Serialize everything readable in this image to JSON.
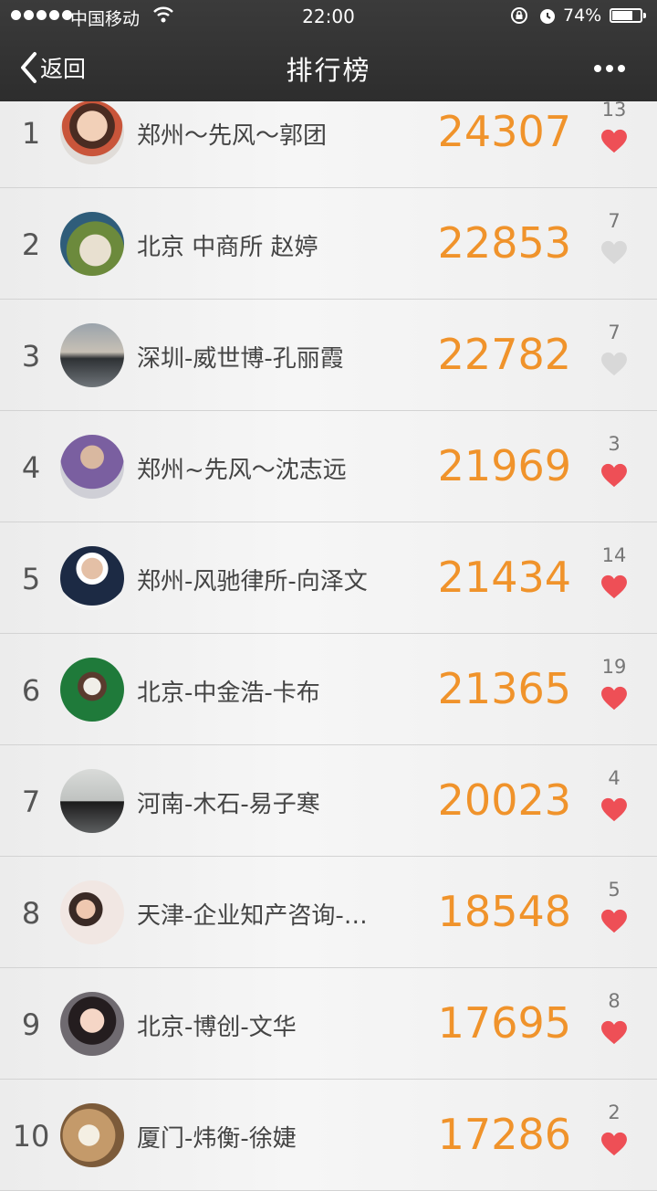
{
  "status_bar": {
    "carrier": "中国移动",
    "time": "22:00",
    "battery_pct": "74%",
    "battery_level": 0.74,
    "icons": [
      "signal-dots-icon",
      "wifi-icon",
      "rotation-lock-icon",
      "alarm-icon",
      "battery-icon"
    ]
  },
  "nav": {
    "back_label": "返回",
    "title": "排行榜"
  },
  "colors": {
    "score": "#f0932b",
    "heart_on": "#ee4f56",
    "heart_off": "#d8d8d8",
    "nav_bg": "#333333"
  },
  "rows": [
    {
      "rank": "1",
      "name": "郑州～先风～郭团",
      "score": "24307",
      "likes": "13",
      "liked": true
    },
    {
      "rank": "2",
      "name": "北京 中商所 赵婷",
      "score": "22853",
      "likes": "7",
      "liked": false
    },
    {
      "rank": "3",
      "name": "深圳-威世博-孔丽霞",
      "score": "22782",
      "likes": "7",
      "liked": false
    },
    {
      "rank": "4",
      "name": "郑州~先风～沈志远",
      "score": "21969",
      "likes": "3",
      "liked": true
    },
    {
      "rank": "5",
      "name": "郑州-风驰律所-向泽文",
      "score": "21434",
      "likes": "14",
      "liked": true
    },
    {
      "rank": "6",
      "name": "北京-中金浩-卡布",
      "score": "21365",
      "likes": "19",
      "liked": true
    },
    {
      "rank": "7",
      "name": "河南-木石-易子寒",
      "score": "20023",
      "likes": "4",
      "liked": true
    },
    {
      "rank": "8",
      "name": "天津-企业知产咨询-…",
      "score": "18548",
      "likes": "5",
      "liked": true
    },
    {
      "rank": "9",
      "name": "北京-博创-文华",
      "score": "17695",
      "likes": "8",
      "liked": true
    },
    {
      "rank": "10",
      "name": "厦门-炜衡-徐婕",
      "score": "17286",
      "likes": "2",
      "liked": true
    }
  ]
}
